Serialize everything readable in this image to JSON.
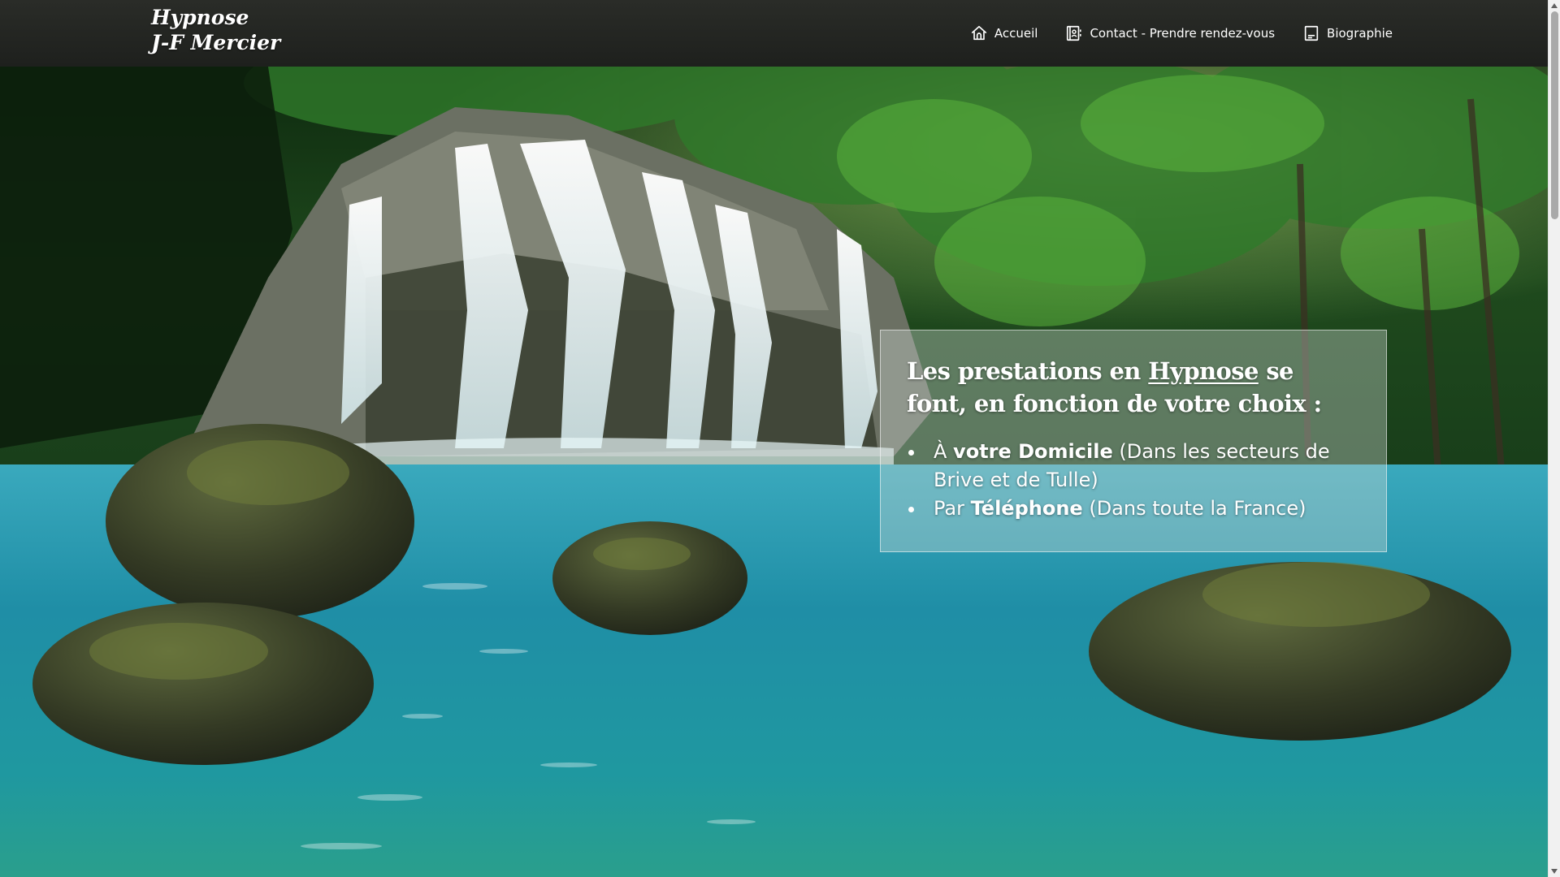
{
  "site": {
    "logo_line1": "Hypnose",
    "logo_line2": "J-F Mercier"
  },
  "nav": {
    "items": [
      {
        "label": "Accueil",
        "icon": "home-icon"
      },
      {
        "label": "Contact - Prendre rendez-vous",
        "icon": "contact-card-icon"
      },
      {
        "label": "Biographie",
        "icon": "document-icon"
      }
    ]
  },
  "hero": {
    "background": "waterfall-lagoon-photo",
    "heading_before": "Les prestations en ",
    "heading_link": "Hypnose",
    "heading_after": " se font, en fonction de votre choix :",
    "services": [
      {
        "prefix": "À ",
        "bold": "votre Domicile",
        "suffix": " (Dans les secteurs de Brive et de Tulle)"
      },
      {
        "prefix": "Par ",
        "bold": "Téléphone",
        "suffix": " (Dans toute la France)"
      }
    ]
  },
  "colors": {
    "header_bg": "#232521",
    "text": "#ffffff",
    "panel_bg": "rgba(205,215,210,0.38)",
    "water": "#1f8fa6",
    "foliage": "#1f5a20"
  }
}
